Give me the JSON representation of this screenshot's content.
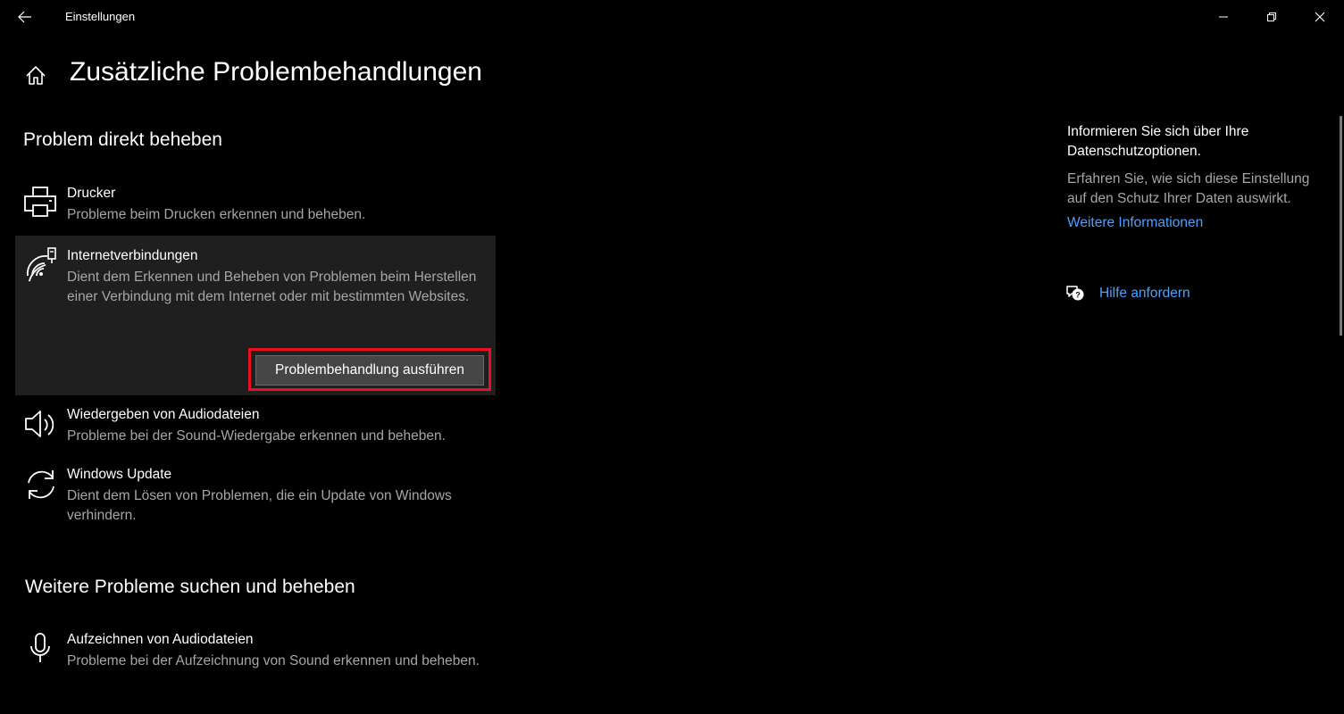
{
  "window": {
    "title": "Einstellungen"
  },
  "page": {
    "title": "Zusätzliche Problembehandlungen"
  },
  "sections": {
    "direct": "Problem direkt beheben",
    "more": "Weitere Probleme suchen und beheben"
  },
  "items": {
    "printer": {
      "name": "Drucker",
      "desc": "Probleme beim Drucken erkennen und beheben.",
      "icon": "printer-icon"
    },
    "internet": {
      "name": "Internetverbindungen",
      "desc": "Dient dem Erkennen und Beheben von Problemen beim Herstellen einer Verbindung mit dem Internet oder mit bestimmten Websites.",
      "icon": "wifi-icon",
      "run_label": "Problembehandlung ausführen"
    },
    "audio": {
      "name": "Wiedergeben von Audiodateien",
      "desc": "Probleme bei der Sound-Wiedergabe erkennen und beheben.",
      "icon": "speaker-icon"
    },
    "update": {
      "name": "Windows Update",
      "desc": "Dient dem Lösen von Problemen, die ein Update von Windows verhindern.",
      "icon": "refresh-icon"
    },
    "record": {
      "name": "Aufzeichnen von Audiodateien",
      "desc": "Probleme bei der Aufzeichnung von Sound erkennen und beheben.",
      "icon": "microphone-icon"
    }
  },
  "sidebar": {
    "privacy_title": "Informieren Sie sich über Ihre Datenschutzoptionen.",
    "privacy_desc": "Erfahren Sie, wie sich diese Einstellung auf den Schutz Ihrer Daten auswirkt.",
    "more_info": "Weitere Informationen",
    "help": "Hilfe anfordern"
  },
  "colors": {
    "accent_link": "#4ca0ff",
    "highlight": "#e81123",
    "background": "#000000",
    "selected_item": "#1f1f1f"
  }
}
